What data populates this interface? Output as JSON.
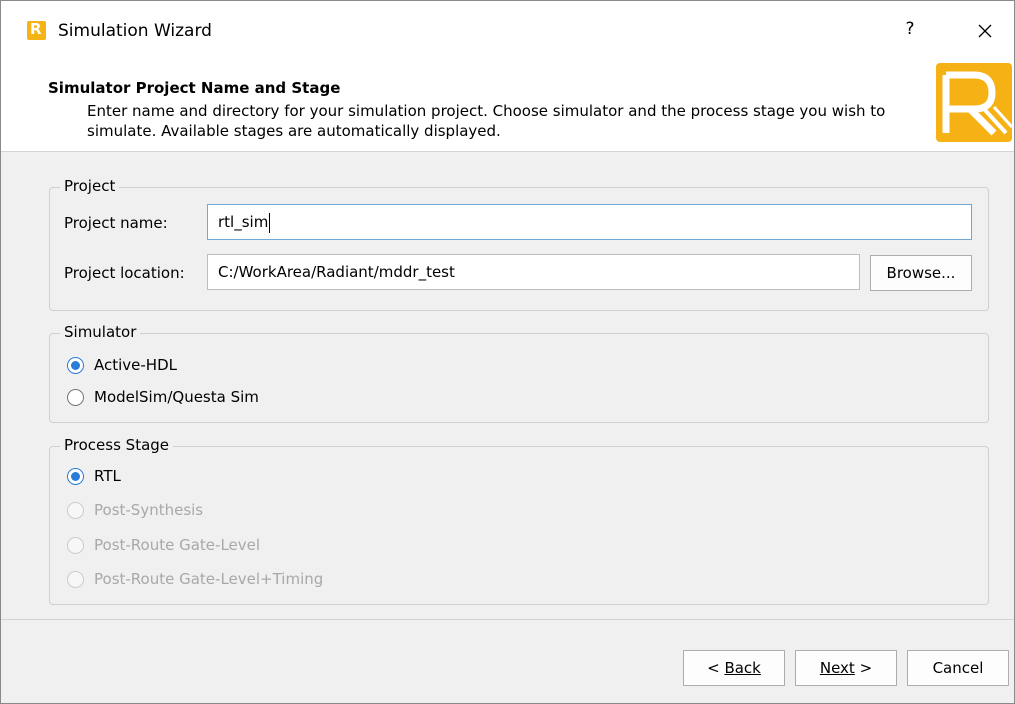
{
  "window": {
    "title": "Simulation Wizard",
    "help_label": "?",
    "app_icon_letter": "R"
  },
  "header": {
    "title": "Simulator Project Name and Stage",
    "description": "Enter name and directory for your simulation project. Choose simulator and the process stage you wish to simulate. Available stages are automatically displayed.",
    "logo_letter": "R"
  },
  "project": {
    "group_title": "Project",
    "name_label": "Project name:",
    "name_value": "rtl_sim",
    "location_label": "Project location:",
    "location_value": "C:/WorkArea/Radiant/mddr_test",
    "browse_label": "Browse..."
  },
  "simulator": {
    "group_title": "Simulator",
    "options": [
      {
        "label": "Active-HDL",
        "checked": true,
        "enabled": true
      },
      {
        "label": "ModelSim/Questa Sim",
        "checked": false,
        "enabled": true
      }
    ]
  },
  "stage": {
    "group_title": "Process Stage",
    "options": [
      {
        "label": "RTL",
        "checked": true,
        "enabled": true
      },
      {
        "label": "Post-Synthesis",
        "checked": false,
        "enabled": false
      },
      {
        "label": "Post-Route Gate-Level",
        "checked": false,
        "enabled": false
      },
      {
        "label": "Post-Route Gate-Level+Timing",
        "checked": false,
        "enabled": false
      }
    ]
  },
  "footer": {
    "back_label": "Back",
    "back_prefix": "< ",
    "next_label": "Next",
    "next_suffix": " >",
    "cancel_label": "Cancel"
  },
  "colors": {
    "accent": "#2b7bd9",
    "logo": "#f6b114"
  }
}
